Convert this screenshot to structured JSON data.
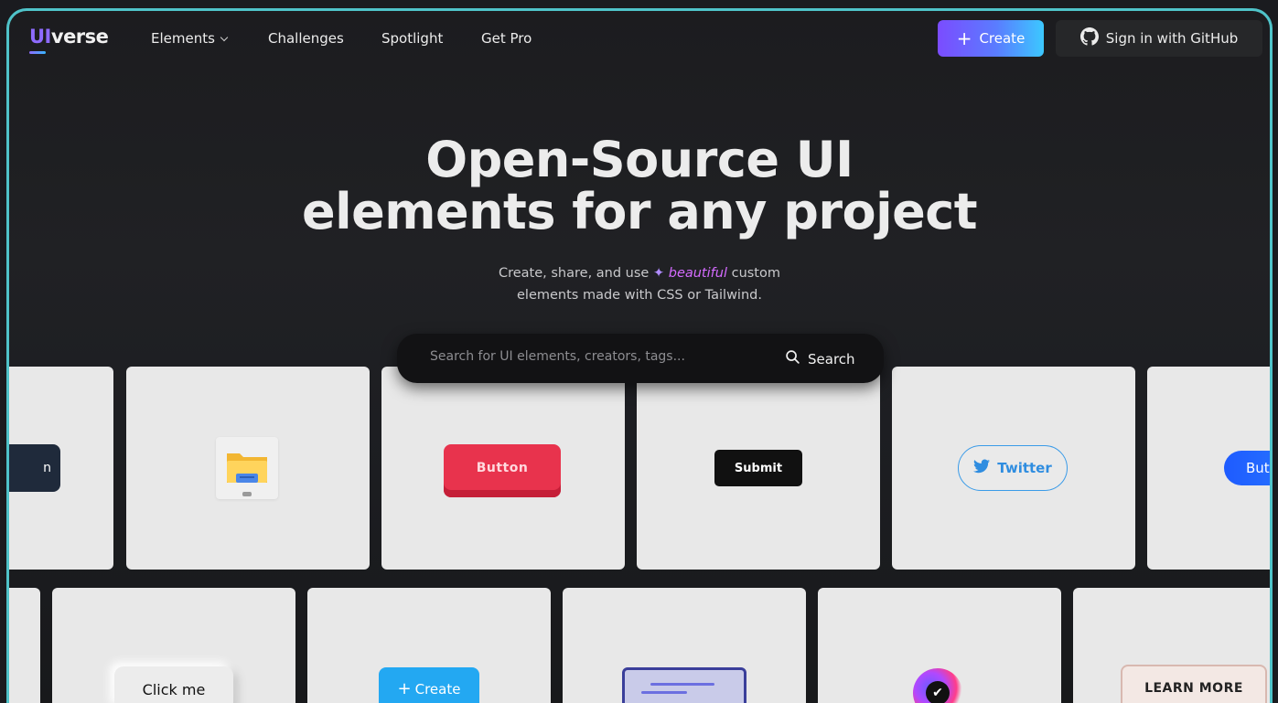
{
  "nav": {
    "logo_ui": "UI",
    "logo_rest": "verse",
    "links": [
      "Elements",
      "Challenges",
      "Spotlight",
      "Get Pro"
    ],
    "create_label": "Create",
    "github_label": "Sign in with GitHub"
  },
  "hero": {
    "title_line1": "Open-Source UI",
    "title_line2": "elements for any project",
    "sub_pre": "Create, share, and use",
    "sub_em": "beautiful",
    "sub_post": "custom",
    "sub_line2": "elements made with CSS or Tailwind."
  },
  "search": {
    "placeholder": "Search for UI elements, creators, tags...",
    "button_label": "Search"
  },
  "cards": {
    "row1": {
      "partial_left_label": "n",
      "red_button": "Button",
      "submit_button": "Submit",
      "twitter_button": "Twitter",
      "blue_button_partial": "Butt"
    },
    "row2": {
      "click_me": "Click me",
      "create": "Create",
      "learn_more": "LEARN MORE"
    }
  },
  "colors": {
    "accent_border": "#4fc3c9",
    "create_gradient_start": "#7b4cff",
    "create_gradient_end": "#3cc8ff",
    "highlight_text": "#d46bff"
  }
}
